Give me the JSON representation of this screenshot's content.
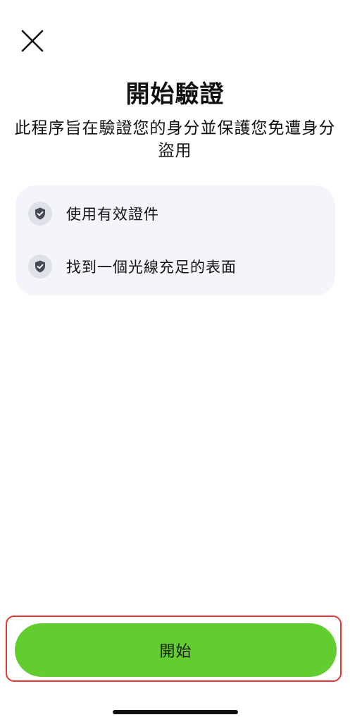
{
  "header": {
    "close_icon": "close-icon"
  },
  "title": "開始驗證",
  "subtitle": "此程序旨在驗證您的身分並保護您免遭身分盜用",
  "requirements": {
    "items": [
      {
        "icon": "shield-check-icon",
        "label": "使用有效證件"
      },
      {
        "icon": "shield-check-icon",
        "label": "找到一個光線充足的表面"
      }
    ]
  },
  "actions": {
    "start_label": "開始"
  },
  "colors": {
    "accent": "#62cd2e",
    "card_background": "#f4f5fa",
    "highlight_border": "#e8372e"
  }
}
